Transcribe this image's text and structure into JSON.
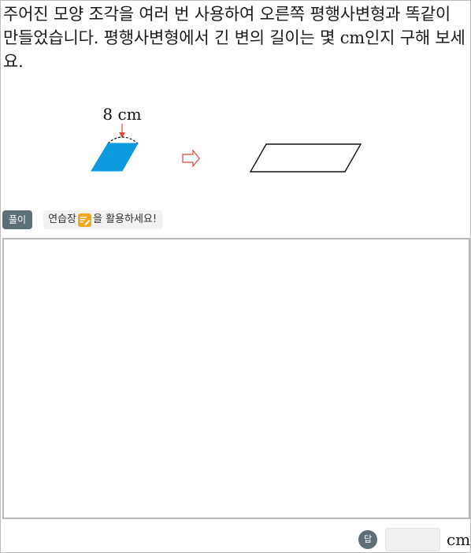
{
  "question": {
    "text": "주어진 모양 조각을 여러 번 사용하여 오른쪽 평행사변형과 똑같이 만들었습니다. 평행사변형에서 긴 변의 길이는 몇 cm인지 구해 보세요."
  },
  "figure": {
    "piece_label": "8 cm",
    "piece_color": "#0d9be0",
    "arrow_color": "#e0463a",
    "piece_icon": "blue-parallelogram-piece",
    "arrow_icon": "hollow-right-arrow",
    "target_icon": "empty-parallelogram"
  },
  "solution": {
    "badge_label": "풀이",
    "practice_before": "연습장",
    "practice_after": "을 활용하세요!",
    "practice_icon": "pencil-note-icon"
  },
  "answer": {
    "badge_label": "답",
    "value": "",
    "unit": "cm"
  }
}
